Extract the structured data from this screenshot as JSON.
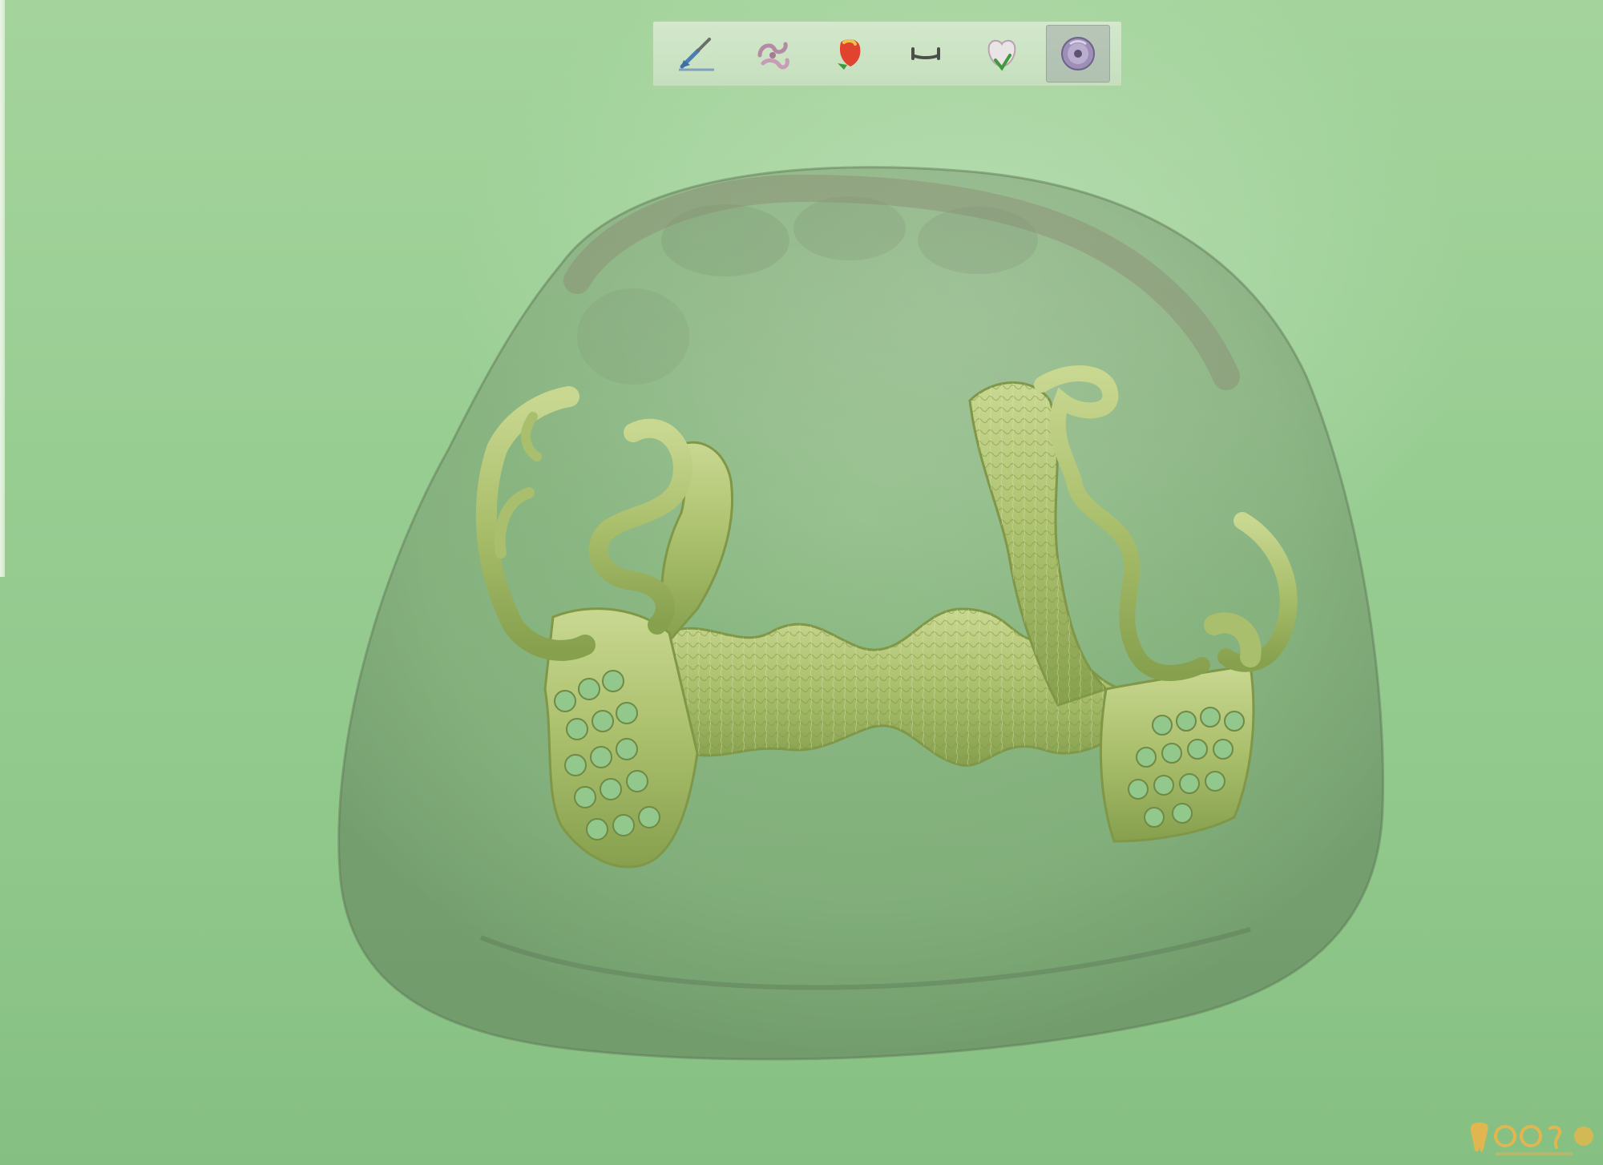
{
  "toolbar": {
    "tools": [
      {
        "icon": "pen-icon"
      },
      {
        "icon": "clasp-icon"
      },
      {
        "icon": "tooth-color-icon"
      },
      {
        "icon": "connector-bar-icon"
      },
      {
        "icon": "crown-tooth-icon"
      },
      {
        "icon": "disc-icon",
        "active": true
      }
    ]
  },
  "colors": {
    "background": "#98cd92",
    "toolbar": "#c9e1c1",
    "framework": "#a9bf6e",
    "model_shell": "#6f8a66"
  }
}
